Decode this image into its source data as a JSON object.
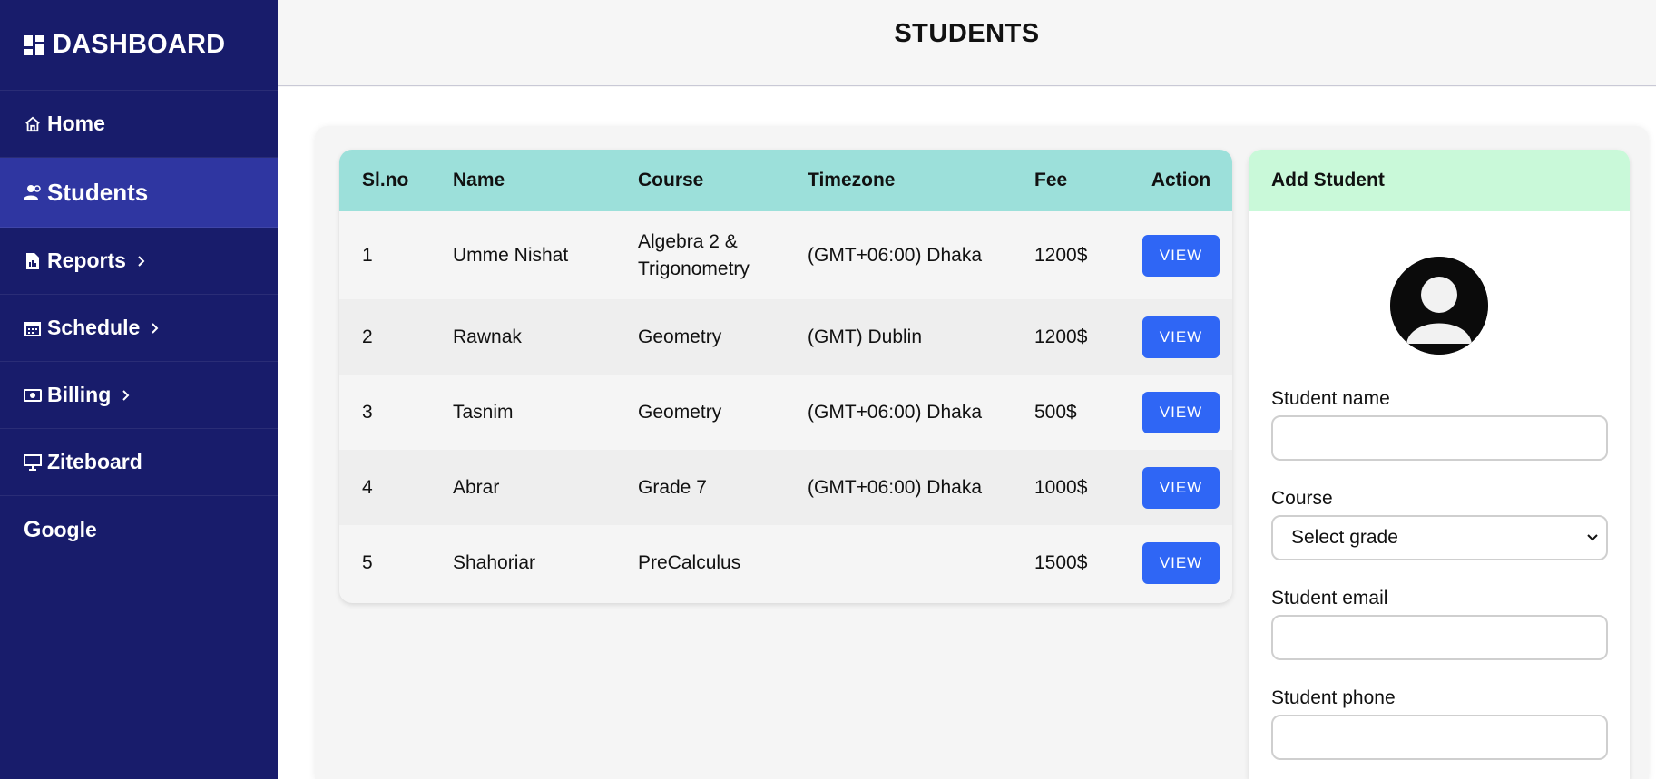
{
  "sidebar": {
    "brand": "DASHBOARD",
    "items": [
      {
        "label": "Home",
        "icon": "home-icon"
      },
      {
        "label": "Students",
        "icon": "users-icon",
        "active": true
      },
      {
        "label": "Reports",
        "icon": "report-icon",
        "has_submenu": true
      },
      {
        "label": "Schedule",
        "icon": "calendar-icon",
        "has_submenu": true
      },
      {
        "label": "Billing",
        "icon": "money-icon",
        "has_submenu": true
      },
      {
        "label": "Ziteboard",
        "icon": "board-icon"
      },
      {
        "label": "oogle",
        "prefix": "G",
        "icon": "google-icon"
      }
    ]
  },
  "header": {
    "title": "STUDENTS"
  },
  "table": {
    "columns": [
      "Sl.no",
      "Name",
      "Course",
      "Timezone",
      "Fee",
      "Action"
    ],
    "rows": [
      {
        "slno": "1",
        "name": "Umme Nishat",
        "course": "Algebra 2 & Trigonometry",
        "timezone": "(GMT+06:00) Dhaka",
        "fee": "1200$",
        "action": "VIEW"
      },
      {
        "slno": "2",
        "name": "Rawnak",
        "course": "Geometry",
        "timezone": "(GMT) Dublin",
        "fee": "1200$",
        "action": "VIEW"
      },
      {
        "slno": "3",
        "name": "Tasnim",
        "course": "Geometry",
        "timezone": "(GMT+06:00) Dhaka",
        "fee": "500$",
        "action": "VIEW"
      },
      {
        "slno": "4",
        "name": "Abrar",
        "course": "Grade 7",
        "timezone": "(GMT+06:00) Dhaka",
        "fee": "1000$",
        "action": "VIEW"
      },
      {
        "slno": "5",
        "name": "Shahoriar",
        "course": "PreCalculus",
        "timezone": "",
        "fee": "1500$",
        "action": "VIEW"
      }
    ]
  },
  "add_student": {
    "title": "Add Student",
    "name_label": "Student name",
    "course_label": "Course",
    "course_selected": "Select grade",
    "email_label": "Student email",
    "phone_label": "Student phone"
  },
  "colors": {
    "sidebar_bg": "#181c6b",
    "sidebar_active": "#2f36a1",
    "table_header": "#9ce0da",
    "add_header": "#c9f9d9",
    "view_button": "#2f66f5"
  }
}
